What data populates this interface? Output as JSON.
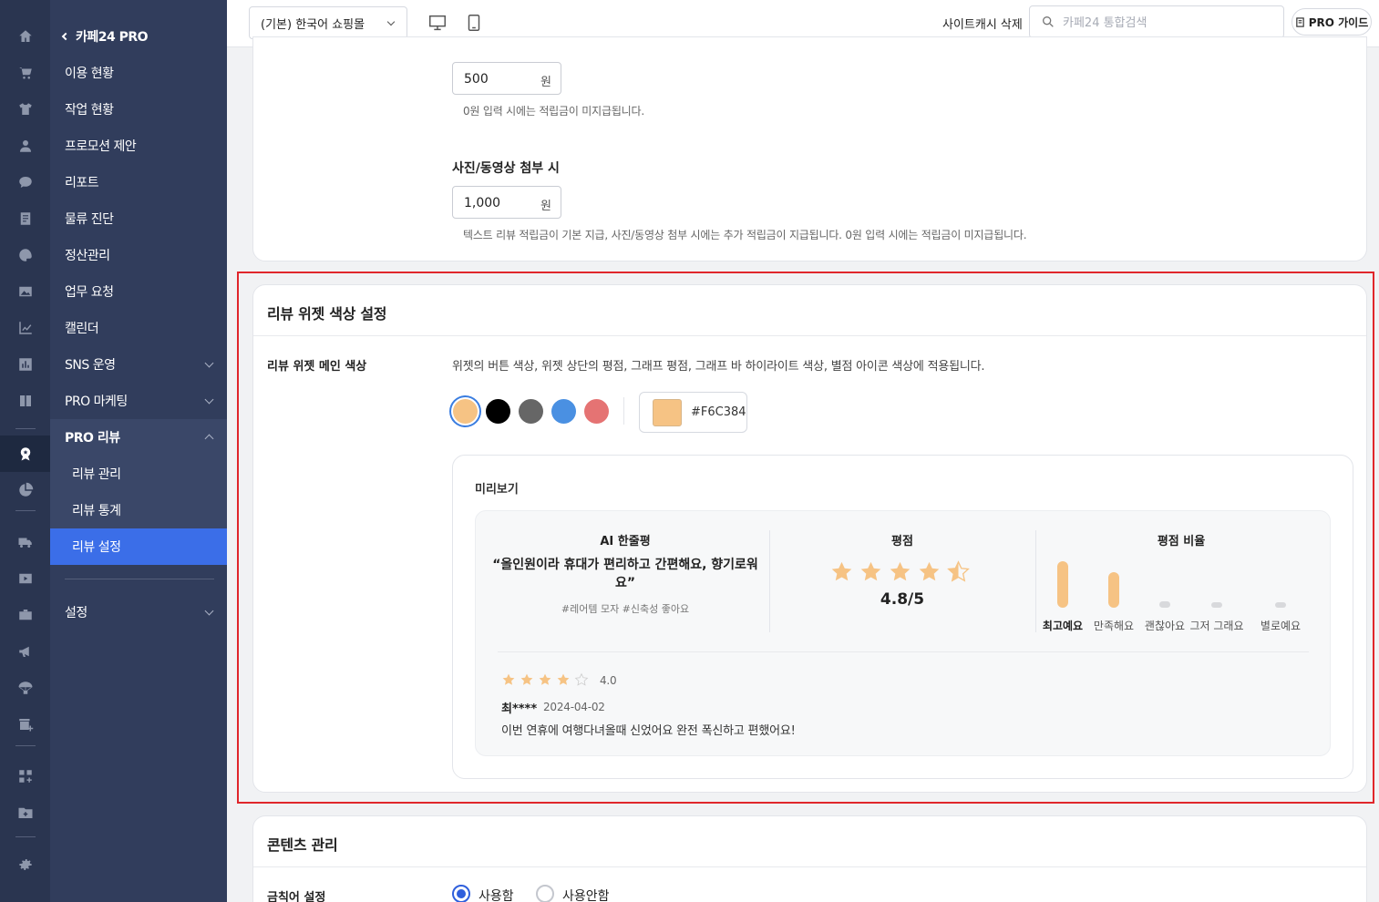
{
  "rail": {
    "icons": [
      "home-icon",
      "cart-icon",
      "shirt-icon",
      "user-icon",
      "chat-icon",
      "document-icon",
      "palette-icon",
      "image-icon",
      "line-chart-icon",
      "bar-chart-icon",
      "book-icon",
      "review-badge-icon",
      "pie-chart-icon",
      "truck-icon",
      "video-icon",
      "briefcase-icon",
      "megaphone-icon",
      "parachute-icon",
      "store-add-icon",
      "apps-add-icon",
      "folder-add-icon",
      "settings-icon"
    ]
  },
  "menu": {
    "title": "카페24 PRO",
    "items": [
      "이용 현황",
      "작업 현황",
      "프로모션 제안",
      "리포트",
      "물류 진단",
      "정산관리",
      "업무 요청",
      "캘린더",
      "SNS 운영",
      "PRO 마케팅",
      "PRO 리뷰"
    ],
    "pro_review_sub": [
      "리뷰 관리",
      "리뷰 통계",
      "리뷰 설정"
    ],
    "settings": "설정"
  },
  "topbar": {
    "mall_select": "(기본) 한국어 쇼핑몰",
    "cache_delete": "사이트캐시 삭제",
    "search_placeholder": "카페24 통합검색",
    "pro_guide": "PRO 가이드"
  },
  "points": {
    "text_amount": "500",
    "unit": "원",
    "text_help": "0원 입력 시에는 적립금이 미지급됩니다.",
    "photo_label": "사진/동영상 첨부 시",
    "photo_amount": "1,000",
    "photo_help": "텍스트 리뷰 적립금이 기본 지급, 사진/동영상 첨부 시에는 추가 적립금이 지급됩니다. 0원 입력 시에는 적립금이 미지급됩니다."
  },
  "widget_color": {
    "section_title": "리뷰 위젯 색상 설정",
    "label": "리뷰 위젯 메인 색상",
    "description": "위젯의 버튼 색상, 위젯 상단의 평점, 그래프 평점, 그래프 바 하이라이트 색상, 별점 아이콘 색상에 적용됩니다.",
    "swatches": [
      "#F6C384",
      "#000000",
      "#666666",
      "#4a90e2",
      "#e57373"
    ],
    "selected_hex": "#F6C384",
    "preview": {
      "title": "미리보기",
      "ai_title": "AI 한줄평",
      "ai_quote": "“올인원이라 휴대가 편리하고 간편해요, 향기로워요”",
      "ai_tags": "#레어템 모자 #신축성 좋아요",
      "rating_title": "평점",
      "rating_value": "4.8/5",
      "ratio_title": "평점 비율",
      "ratio_labels": [
        "최고예요",
        "만족해요",
        "괜찮아요",
        "그저 그래요",
        "별로예요"
      ],
      "ratio_values": [
        0.85,
        0.65,
        0.12,
        0.05,
        0.05
      ],
      "review_score": "4.0",
      "reviewer": "최****",
      "review_date": "2024-04-02",
      "review_text": "이번 연휴에 여행다녀올때 신었어요 완전 폭신하고 편했어요!"
    }
  },
  "content_mgmt": {
    "section_title": "콘텐츠 관리",
    "banned_words_label": "금칙어 설정",
    "option_use": "사용함",
    "option_not_use": "사용안함"
  }
}
